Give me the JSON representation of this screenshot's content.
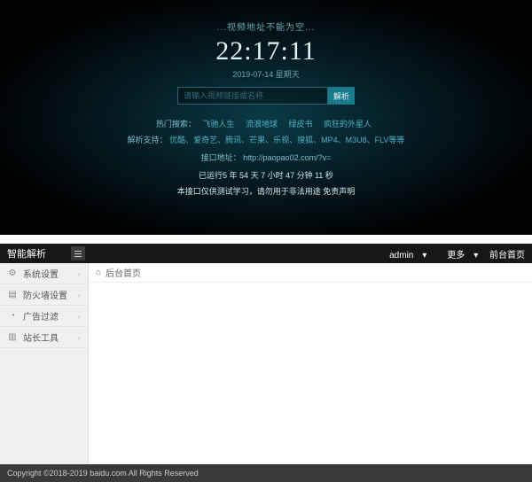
{
  "hero": {
    "tagline": "...视频地址不能为空...",
    "clock": "22:17:11",
    "date": "2019-07-14 星期天",
    "search_placeholder": "请输入视频链接或名称",
    "parse_btn": "解析",
    "hot_label": "热门搜索：",
    "hot_links": [
      "飞驰人生",
      "流浪地球",
      "绿皮书",
      "疯狂的外星人"
    ],
    "support_label": "解析支持：",
    "support_text": "优酷、爱奇艺、腾讯、芒果、乐视、搜狐、MP4、M3U8、FLV等等",
    "api_label": "接口地址：",
    "api_url": "http://paopao02.com/?v=",
    "uptime": "已运行5 年 54 天 7 小时 47 分钟 11 秒",
    "disclaimer_prefix": "本接口仅供测试学习，请勿用于非法用途  ",
    "disclaimer_link": "免责声明"
  },
  "admin": {
    "brand": "智能解析",
    "user": "admin",
    "more": "更多",
    "home_link": "前台首页",
    "sidebar": [
      {
        "icon": "⚙",
        "label": "系统设置"
      },
      {
        "icon": "▤",
        "label": "防火墙设置"
      },
      {
        "icon": "◔",
        "label": "广告过滤"
      },
      {
        "icon": "▥",
        "label": "站长工具"
      }
    ],
    "tab": "后台首页"
  },
  "footer": "Copyright ©2018-2019 baidu.com All Rights Reserved"
}
